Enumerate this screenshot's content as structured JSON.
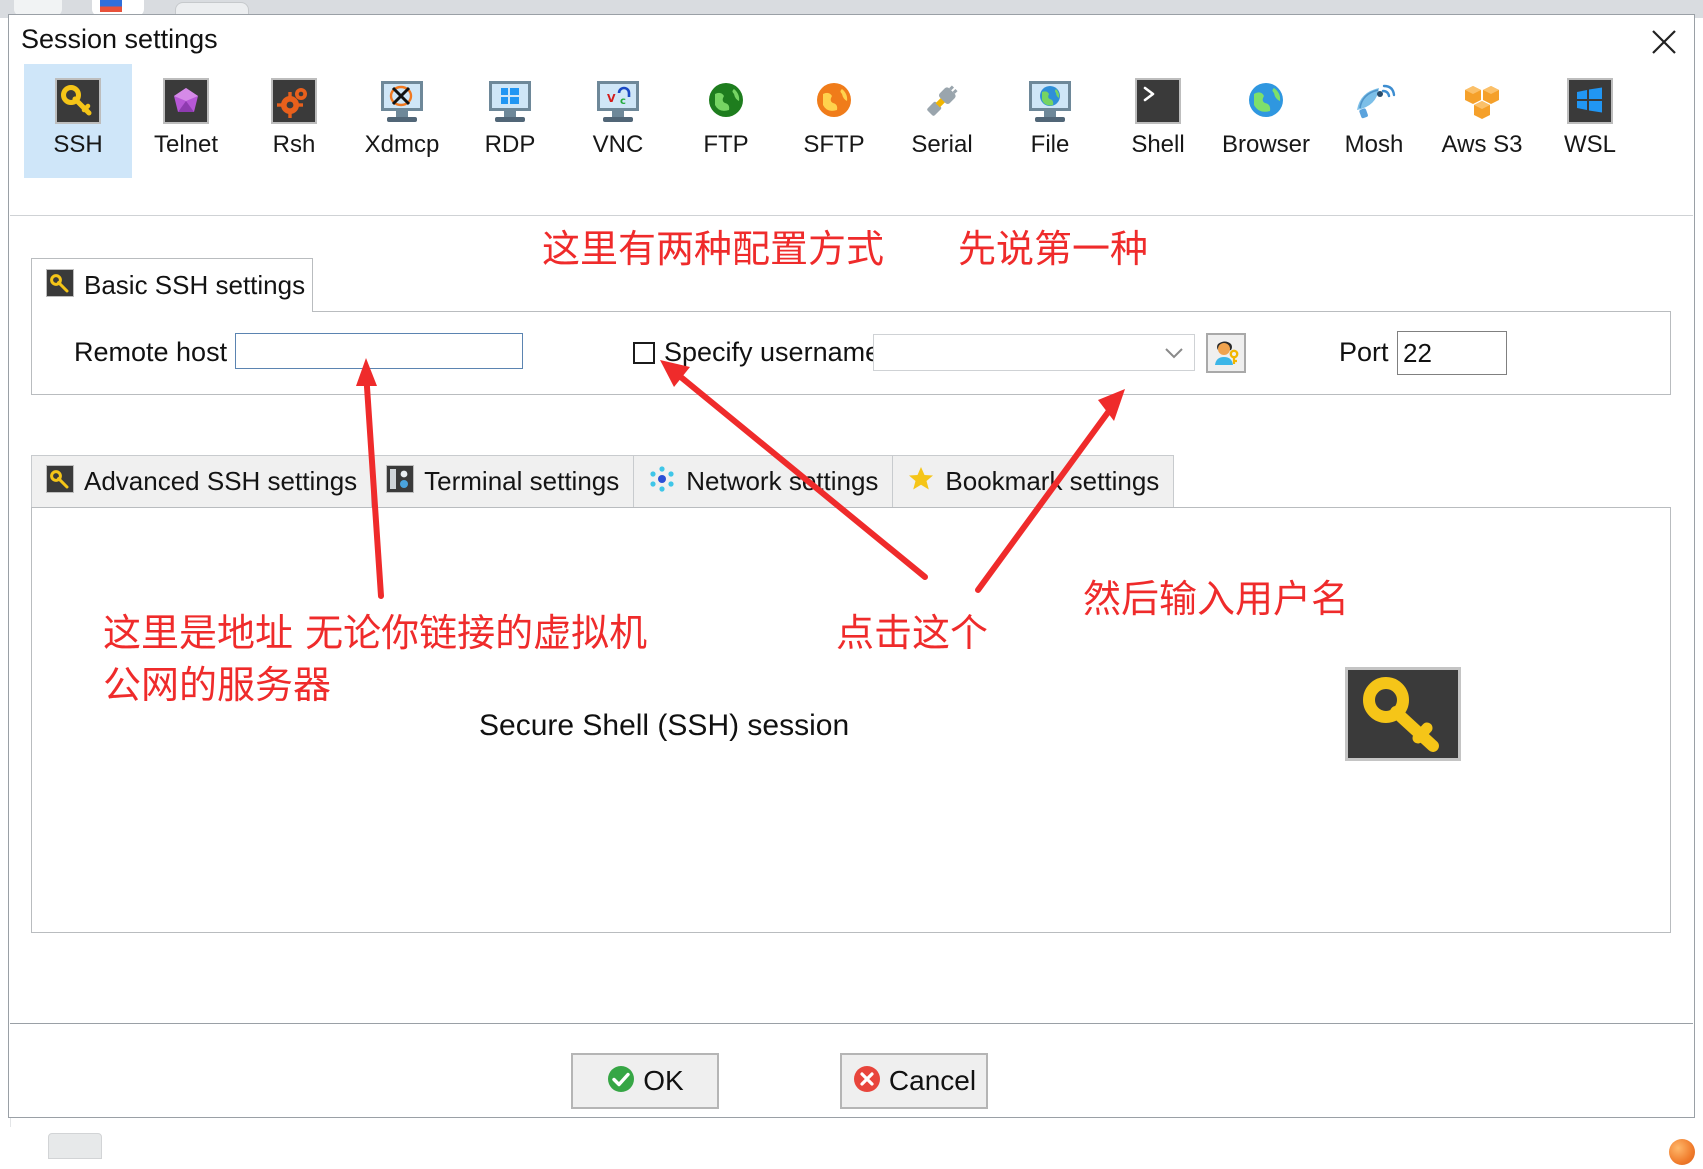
{
  "window": {
    "title": "Session settings",
    "close_icon": "close-icon"
  },
  "protocols": [
    {
      "label": "SSH",
      "icon": "key-icon",
      "selected": true
    },
    {
      "label": "Telnet",
      "icon": "gem-icon",
      "selected": false
    },
    {
      "label": "Rsh",
      "icon": "gears-icon",
      "selected": false
    },
    {
      "label": "Xdmcp",
      "icon": "x-monitor-icon",
      "selected": false
    },
    {
      "label": "RDP",
      "icon": "windows-monitor-icon",
      "selected": false
    },
    {
      "label": "VNC",
      "icon": "vnc-monitor-icon",
      "selected": false
    },
    {
      "label": "FTP",
      "icon": "green-globe-icon",
      "selected": false
    },
    {
      "label": "SFTP",
      "icon": "orange-globe-icon",
      "selected": false
    },
    {
      "label": "Serial",
      "icon": "plug-icon",
      "selected": false
    },
    {
      "label": "File",
      "icon": "globe-monitor-icon",
      "selected": false
    },
    {
      "label": "Shell",
      "icon": "terminal-icon",
      "selected": false
    },
    {
      "label": "Browser",
      "icon": "blue-globe-icon",
      "selected": false
    },
    {
      "label": "Mosh",
      "icon": "satellite-icon",
      "selected": false
    },
    {
      "label": "Aws S3",
      "icon": "aws-cubes-icon",
      "selected": false
    },
    {
      "label": "WSL",
      "icon": "windows-icon",
      "selected": false
    }
  ],
  "basic": {
    "tab_label": "Basic SSH settings",
    "tab_icon": "key-icon",
    "remote_host_label": "Remote host *",
    "remote_host_value": "",
    "remote_host_placeholder": "",
    "specify_username_label": "Specify username",
    "specify_username_checked": false,
    "username_value": "",
    "username_placeholder": "",
    "username_dropdown_icon": "chevron-down-icon",
    "user_key_button_icon": "user-key-icon",
    "port_label": "Port",
    "port_value": "22",
    "port_spinner_up_icon": "spinner-up-icon",
    "port_spinner_down_icon": "spinner-down-icon"
  },
  "settings_tabs": [
    {
      "label": "Advanced SSH settings",
      "icon": "key-icon",
      "active": false
    },
    {
      "label": "Terminal settings",
      "icon": "terminal-gear-icon",
      "active": false
    },
    {
      "label": "Network settings",
      "icon": "network-icon",
      "active": false
    },
    {
      "label": "Bookmark settings",
      "icon": "star-icon",
      "active": false
    }
  ],
  "panel": {
    "session_caption": "Secure Shell (SSH) session",
    "big_icon": "key-icon"
  },
  "footer": {
    "ok_label": "OK",
    "ok_icon": "check-circle-icon",
    "cancel_label": "Cancel",
    "cancel_icon": "x-circle-icon"
  },
  "annotations": {
    "color": "#EF2B2B",
    "a1": "这里有两种配置方式",
    "a2": "先说第一种",
    "a3": "这里是地址 无论你链接的虚拟机\n公网的服务器",
    "a4": "点击这个",
    "a5": "然后输入用户名"
  }
}
